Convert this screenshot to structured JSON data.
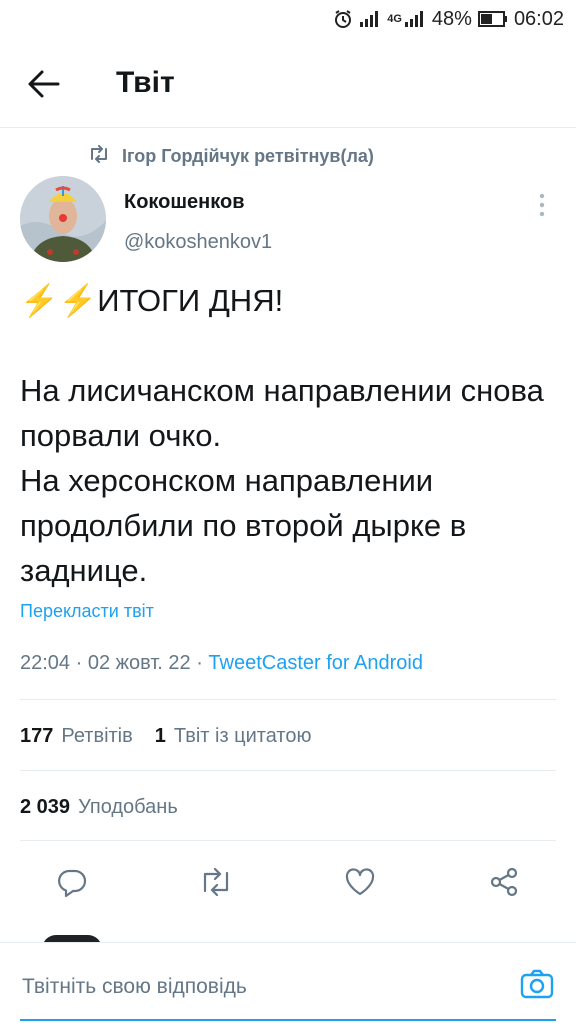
{
  "status_bar": {
    "network": "4G",
    "battery": "48%",
    "time": "06:02",
    "icons": [
      "alarm-icon",
      "signal-icon",
      "signal-4g-icon",
      "battery-icon"
    ]
  },
  "header": {
    "title": "Твіт",
    "back_icon": "arrow-left-icon"
  },
  "retweet": {
    "text": "Ігор Гордійчук ретвітнув(ла)",
    "icon": "retweet-icon"
  },
  "author": {
    "display_name": "Кокошенков",
    "username": "@kokoshenkov1"
  },
  "tweet": {
    "text": "⚡⚡ИТОГИ ДНЯ!\n\nНа лисичанском направлении снова порвали очко.\nНа херсонском направлении продолбили по второй дырке в заднице."
  },
  "translate_label": "Перекласти твіт",
  "meta": {
    "time": "22:04",
    "sep1": " · ",
    "date": "02 жовт. 22",
    "sep2": " · ",
    "client": "TweetCaster for Android"
  },
  "stats": {
    "retweets_count": "177",
    "retweets_label": "Ретвітів",
    "quotes_count": "1",
    "quotes_label": "Твіт із цитатою",
    "likes_count": "2 039",
    "likes_label": "Уподобань"
  },
  "actions": [
    "reply-icon",
    "retweet-icon",
    "like-icon",
    "share-icon"
  ],
  "reply_box": {
    "placeholder": "Твітніть свою відповідь",
    "camera_icon": "camera-icon"
  },
  "colors": {
    "accent": "#1da1f2",
    "secondary_text": "#657786",
    "divider": "#e6ecf0"
  }
}
